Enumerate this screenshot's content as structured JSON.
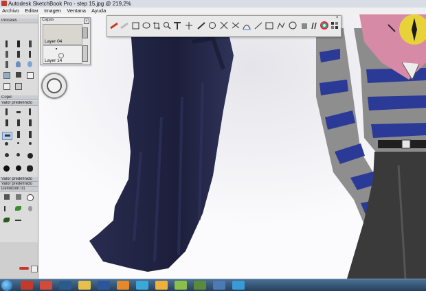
{
  "window": {
    "title": "Autodesk SketchBook Pro - step 15.jpg @ 219,2%"
  },
  "menu": [
    "Archivo",
    "Editar",
    "Imagen",
    "Ventana",
    "Ayuda"
  ],
  "brush_panel": {
    "title": "Pinceles",
    "sections": [
      "Copic",
      "Valor predefinido",
      "Valor predefinido",
      "Valor predefinido",
      "Definición 01"
    ]
  },
  "layers": {
    "title": "Capas",
    "items": [
      "Layer 04",
      "Layer 14"
    ]
  },
  "toolbar": {
    "icons": [
      "brush-icon",
      "eraser-icon",
      "rect-select-icon",
      "lasso-icon",
      "crop-icon",
      "zoom-icon",
      "text-icon",
      "transform-icon",
      "ruler-icon",
      "ellipse-guide-icon",
      "symmetry-icon",
      "line-icon",
      "rectangle-icon",
      "polyline-icon",
      "ellipse-icon",
      "fill-icon",
      "brush-palette-icon",
      "color-wheel-icon",
      "layer-editor-icon"
    ]
  },
  "colors": {
    "hair": "#1f2140",
    "stripe_blue": "#2b3a97",
    "stripe_gray": "#8c8c8c",
    "skin_pink": "#d68aa6",
    "eye_yellow": "#e8d23a",
    "pants": "#3a3a3a"
  },
  "taskbar": {
    "apps": [
      "start-button",
      "sketchbook-icon",
      "chrome-icon",
      "media-icon",
      "explorer-icon",
      "word-icon",
      "firefox-icon",
      "aim-icon",
      "pencil-icon",
      "paint-icon",
      "flower-icon",
      "outlook-icon",
      "skype-icon",
      "window-icon"
    ]
  }
}
